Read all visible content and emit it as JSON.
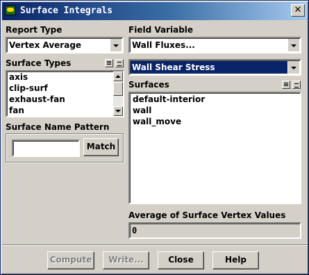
{
  "window": {
    "title": "Surface Integrals",
    "close_glyph": "✕"
  },
  "report_type": {
    "label": "Report Type",
    "value": "Vertex Average"
  },
  "field_variable": {
    "label": "Field Variable",
    "category": "Wall Fluxes...",
    "variable": "Wall Shear Stress"
  },
  "surface_types": {
    "label": "Surface Types",
    "items": [
      "axis",
      "clip-surf",
      "exhaust-fan",
      "fan"
    ]
  },
  "surface_name_pattern": {
    "label": "Surface Name Pattern",
    "value": "",
    "match_label": "Match"
  },
  "surfaces": {
    "label": "Surfaces",
    "items": [
      "default-interior",
      "wall",
      "wall_move"
    ]
  },
  "result": {
    "label": "Average of Surface Vertex Values",
    "value": "0"
  },
  "buttons": {
    "compute": "Compute",
    "write": "Write...",
    "close": "Close",
    "help": "Help"
  },
  "colors": {
    "face": "#d4d0c8",
    "title_start": "#0a246a",
    "title_end": "#a6caf0",
    "selection": "#0a246a"
  },
  "icons": [
    "app-icon",
    "close-icon",
    "dropdown-arrow-icon",
    "select-all-icon",
    "deselect-all-icon"
  ]
}
